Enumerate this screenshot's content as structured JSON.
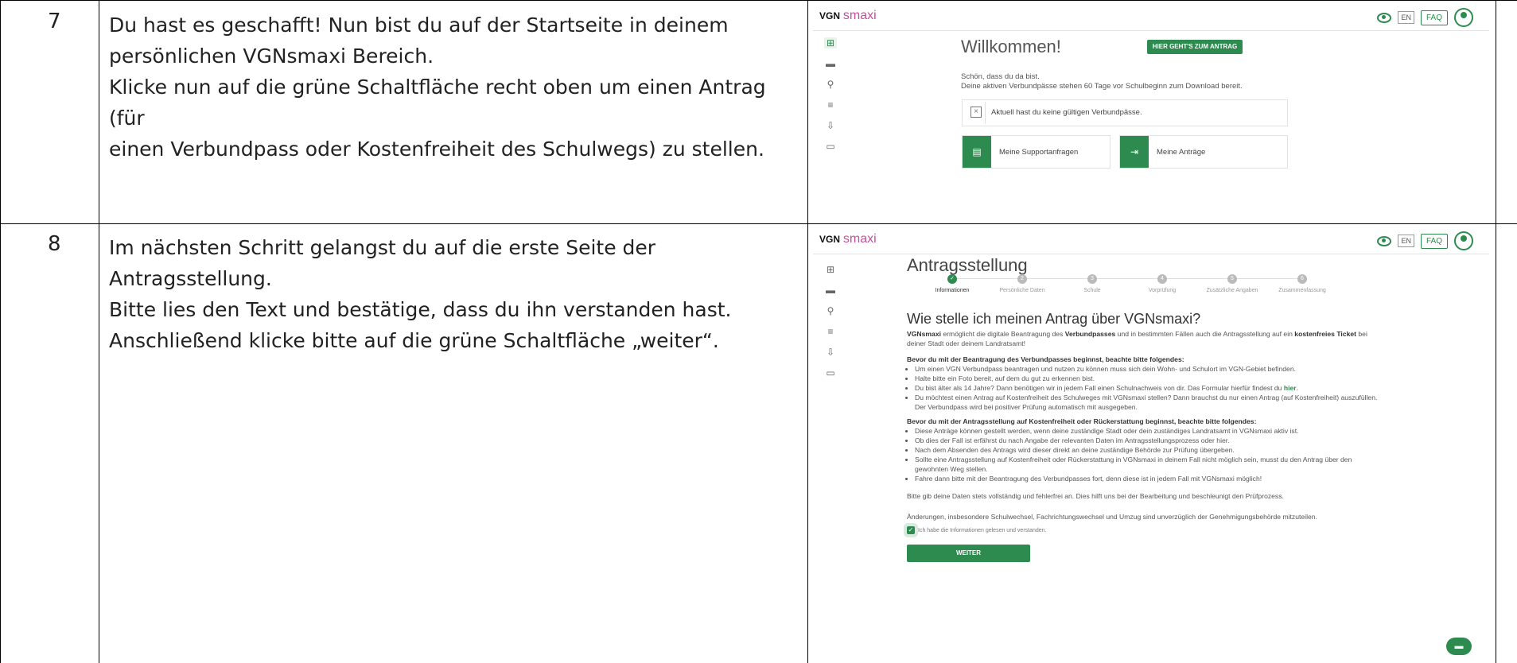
{
  "rows": [
    {
      "number": "7",
      "lines": [
        "Du hast es geschafft! Nun bist du auf der Startseite in deinem",
        "persönlichen VGNsmaxi Bereich.",
        "Klicke nun auf die grüne Schaltfläche recht oben um einen Antrag (für",
        "einen Verbundpass oder Kostenfreiheit des Schulwegs) zu stellen."
      ]
    },
    {
      "number": "8",
      "lines": [
        "Im nächsten Schritt gelangst du auf die erste Seite der Antragsstellung.",
        "Bitte lies den Text und bestätige, dass du ihn verstanden hast.",
        "Anschließend klicke bitte auf die grüne Schaltfläche „weiter“."
      ]
    }
  ],
  "app": {
    "logo_vgn": "VGN",
    "logo_smaxi": "smaxi",
    "lang": "EN",
    "faq": "FAQ"
  },
  "welcome": {
    "title": "Willkommen!",
    "cta": "HIER GEHT'S ZUM ANTRAG",
    "greeting": "Schön, dass du da bist.",
    "info": "Deine aktiven Verbundpässe stehen 60 Tage vor Schulbeginn zum Download bereit.",
    "no_pass": "Aktuell hast du keine gültigen Verbundpässe.",
    "support": "Meine Supportanfragen",
    "antraege": "Meine Anträge"
  },
  "antrag": {
    "title": "Antragsstellung",
    "steps": [
      {
        "label": "Informationen",
        "active": true
      },
      {
        "label": "Persönliche Daten",
        "active": false
      },
      {
        "label": "Schule",
        "active": false
      },
      {
        "label": "Vorprüfung",
        "active": false
      },
      {
        "label": "Zusätzliche Angaben",
        "active": false
      },
      {
        "label": "Zusammenfassung",
        "active": false
      }
    ],
    "heading": "Wie stelle ich meinen Antrag über VGNsmaxi?",
    "intro_1": "VGNsmaxi",
    "intro_2": " ermöglicht die digitale Beantragung des ",
    "intro_3": "Verbundpasses",
    "intro_4": " und in bestimmten Fällen auch die Antragsstellung auf ein ",
    "intro_5": "kostenfreies Ticket",
    "intro_6": " bei deiner Stadt oder deinem Landratsamt!",
    "section1_title": "Bevor du mit der Beantragung des Verbundpasses beginnst, beachte bitte folgendes:",
    "section1_items": [
      "Um einen VGN Verbundpass beantragen und nutzen zu können muss sich dein Wohn- und Schulort im VGN-Gebiet befinden.",
      "Halte bitte ein Foto bereit, auf dem du gut zu erkennen bist.",
      "Du bist älter als 14 Jahre? Dann benötigen wir in jedem Fall einen Schulnachweis von dir. Das Formular hierfür findest du ",
      "Du möchtest einen Antrag auf Kostenfreiheit des Schulweges mit VGNsmaxi stellen? Dann brauchst du nur einen Antrag (auf Kostenfreiheit) auszufüllen. Der Verbundpass wird bei positiver Prüfung automatisch mit ausgegeben."
    ],
    "here_link": "hier",
    "section2_title": "Bevor du mit der Antragsstellung auf Kostenfreiheit oder Rückerstattung beginnst, beachte bitte folgendes:",
    "section2_items": [
      "Diese Anträge können gestellt werden, wenn deine zuständige Stadt oder dein zuständiges Landratsamt in VGNsmaxi aktiv ist.",
      "Ob dies der Fall ist erfährst du nach Angabe der relevanten Daten im Antragsstellungsprozess oder hier.",
      "Nach dem Absenden des Antrags wird dieser direkt an deine zuständige Behörde zur Prüfung übergeben.",
      "Sollte eine Antragsstellung auf Kostenfreiheit oder Rückerstattung in VGNsmaxi in deinem Fall nicht möglich sein, musst du den Antrag über den gewohnten Weg stellen.",
      "Fahre dann bitte mit der Beantragung des Verbundpasses fort, denn diese ist in jedem Fall mit VGNsmaxi möglich!"
    ],
    "note1": "Bitte gib deine Daten stets vollständig und fehlerfrei an. Dies hilft uns bei der Bearbeitung und beschleunigt den Prüfprozess.",
    "note2": "Änderungen, insbesondere Schulwechsel, Fachrichtungswechsel und Umzug sind unverzüglich der Genehmigungsbehörde mitzuteilen.",
    "checkbox": "Ich habe die Informationen gelesen und verstanden.",
    "weiter": "WEITER"
  }
}
